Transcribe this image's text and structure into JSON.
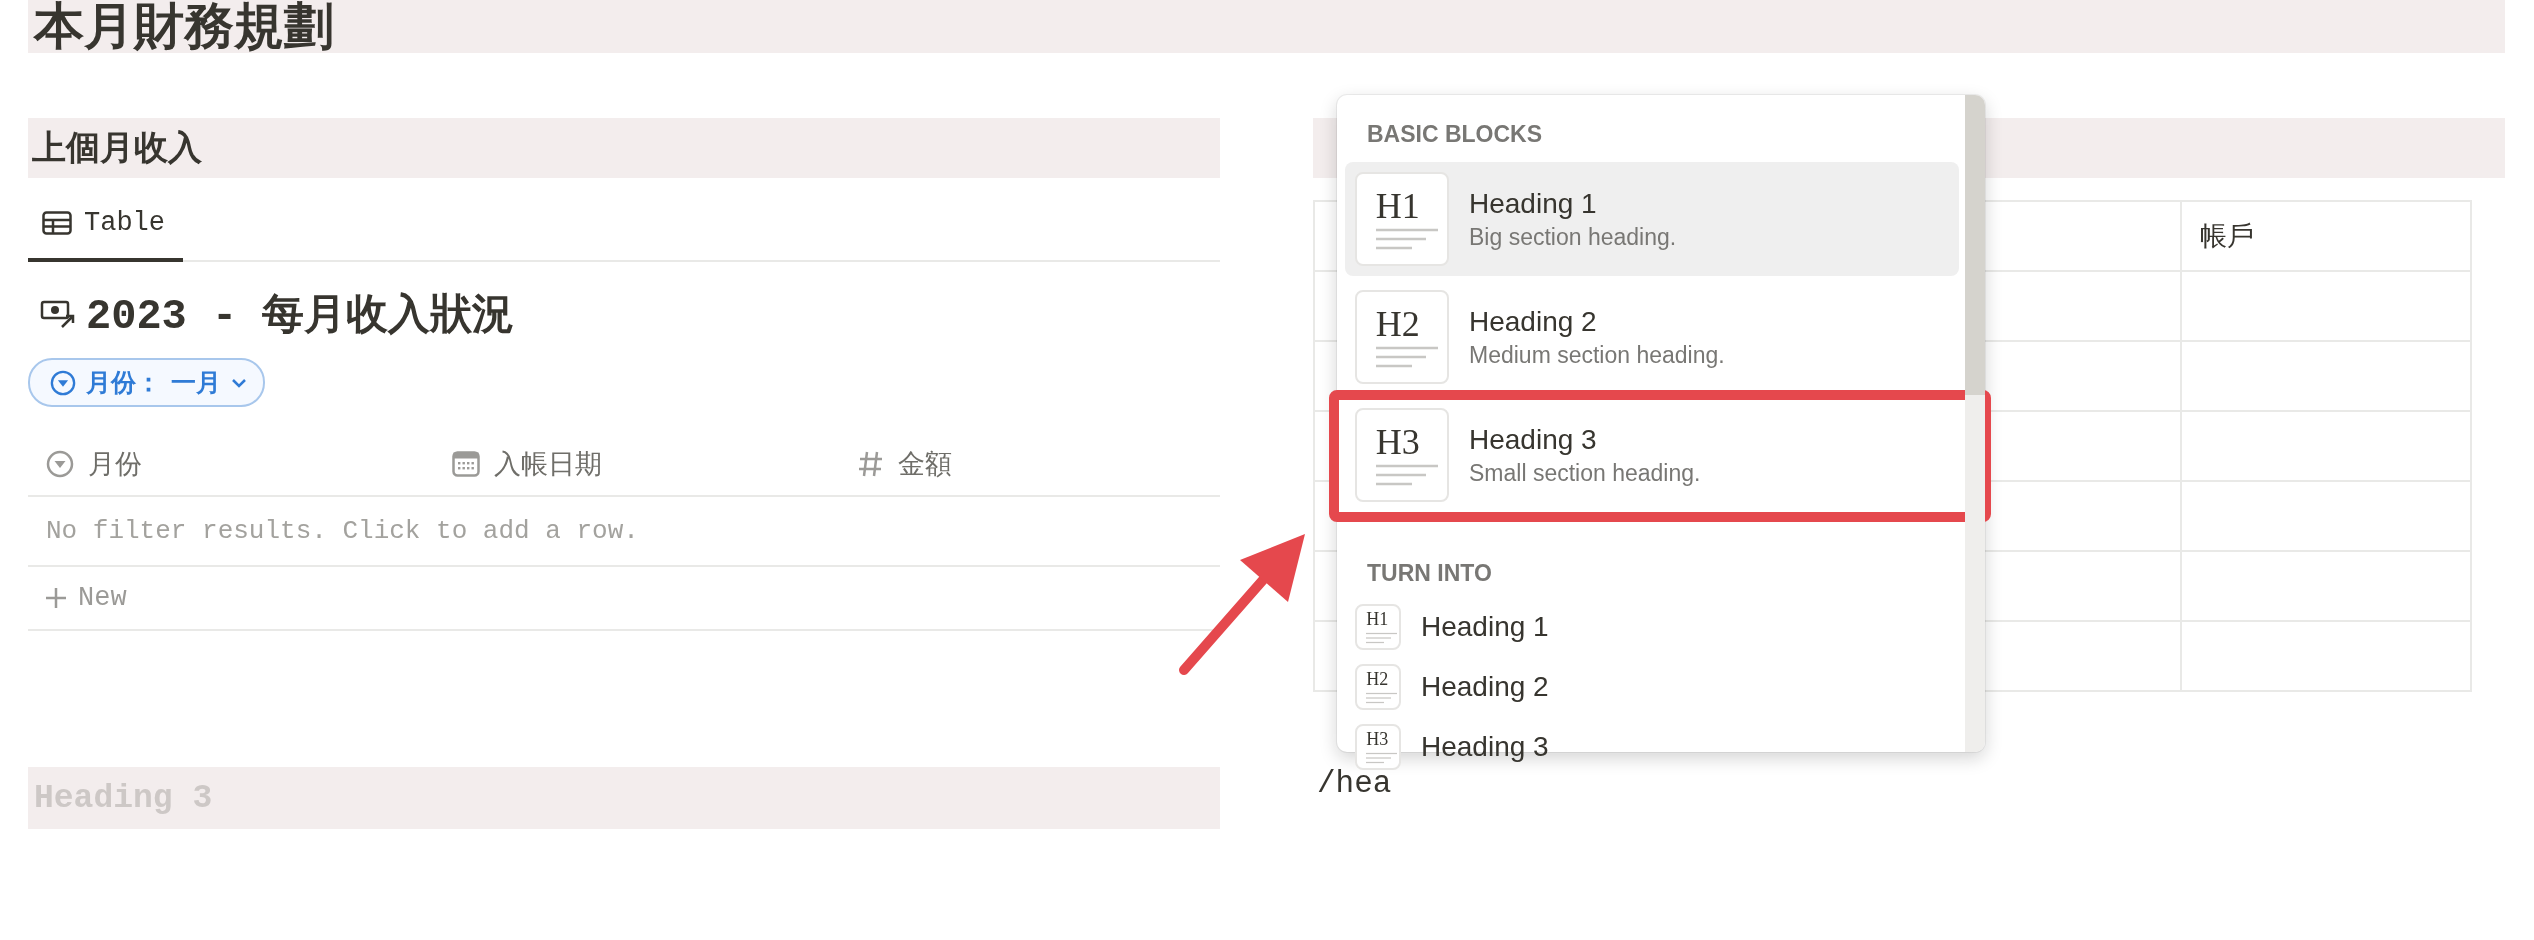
{
  "page_title": "本月財務規劃",
  "left_section": {
    "heading": "上個月收入",
    "view_tabs": [
      {
        "label": "Table",
        "selected": true
      }
    ],
    "database_title": "2023 - 每月收入狀況",
    "filter": {
      "label": "月份：",
      "value": "一月"
    },
    "columns": [
      {
        "kind": "select",
        "label": "月份"
      },
      {
        "kind": "date",
        "label": "入帳日期"
      },
      {
        "kind": "number",
        "label": "金額"
      }
    ],
    "empty_message": "No filter results. Click to add a row.",
    "new_row": "New"
  },
  "empty_heading": {
    "placeholder": "Heading 3"
  },
  "right_section": {
    "table": {
      "last_column_header": "帳戶"
    },
    "command_text": "/hea"
  },
  "menu": {
    "sections": [
      {
        "title": "BASIC BLOCKS",
        "kind": "large",
        "items": [
          {
            "icon_label": "H1",
            "title": "Heading 1",
            "description": "Big section heading.",
            "selected": true,
            "annotated": false
          },
          {
            "icon_label": "H2",
            "title": "Heading 2",
            "description": "Medium section heading.",
            "selected": false,
            "annotated": false
          },
          {
            "icon_label": "H3",
            "title": "Heading 3",
            "description": "Small section heading.",
            "selected": false,
            "annotated": true
          }
        ]
      },
      {
        "title": "TURN INTO",
        "kind": "compact",
        "items": [
          {
            "icon_label": "H1",
            "title": "Heading 1",
            "selected": false,
            "annotated": false
          },
          {
            "icon_label": "H2",
            "title": "Heading 2",
            "selected": false,
            "annotated": false
          },
          {
            "icon_label": "H3",
            "title": "Heading 3",
            "selected": false,
            "annotated": false
          }
        ]
      }
    ]
  }
}
